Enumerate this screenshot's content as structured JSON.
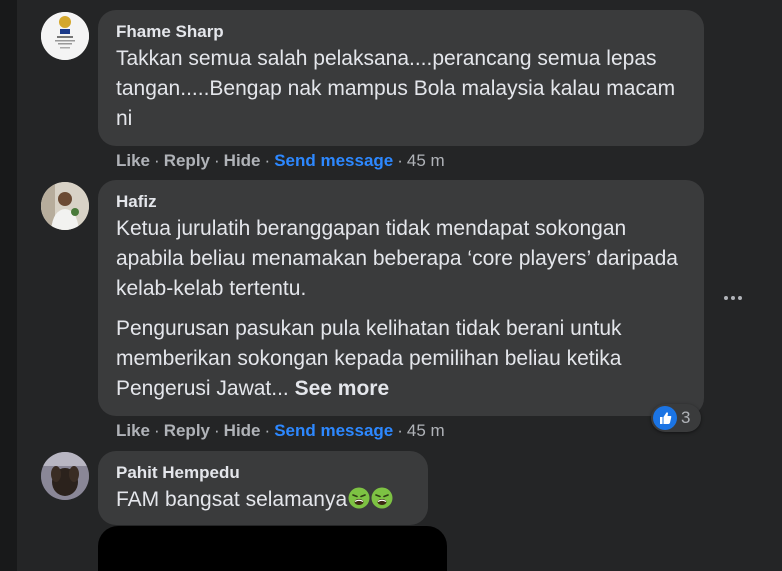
{
  "comments": [
    {
      "author": "Fhame Sharp",
      "text": "Takkan semua salah pelaksana....perancang semua lepas tangan.....Bengap nak mampus Bola malaysia kalau macam ni",
      "actions": {
        "like": "Like",
        "reply": "Reply",
        "hide": "Hide",
        "send": "Send message",
        "time": "45 m"
      },
      "avatar_icon": "fam-logo-avatar"
    },
    {
      "author": "Hafiz",
      "text": "Ketua jurulatih beranggapan tidak mendapat sokongan apabila beliau menamakan beberapa ‘core players’ daripada kelab-kelab tertentu.",
      "text2": "Pengurusan pasukan pula kelihatan tidak berani untuk memberikan sokongan kepada pemilihan beliau ketika Pengerusi Jawat... ",
      "see_more": "See more",
      "actions": {
        "like": "Like",
        "reply": "Reply",
        "hide": "Hide",
        "send": "Send message",
        "time": "45 m"
      },
      "reactions": {
        "icon": "like-icon",
        "count": "3"
      },
      "avatar_icon": "person-photo-avatar"
    },
    {
      "author": "Pahit Hempedu",
      "text": "FAM bangsat selamanya",
      "emojis": [
        "nauseated-face-icon",
        "nauseated-face-icon"
      ],
      "avatar_icon": "dog-photo-avatar"
    }
  ],
  "more_options_icon": "ellipsis-icon",
  "colors": {
    "link": "#2d88ff",
    "bubble": "#3a3b3c",
    "panel": "#242526",
    "text": "#e4e6eb",
    "muted": "#b0b3b8"
  }
}
